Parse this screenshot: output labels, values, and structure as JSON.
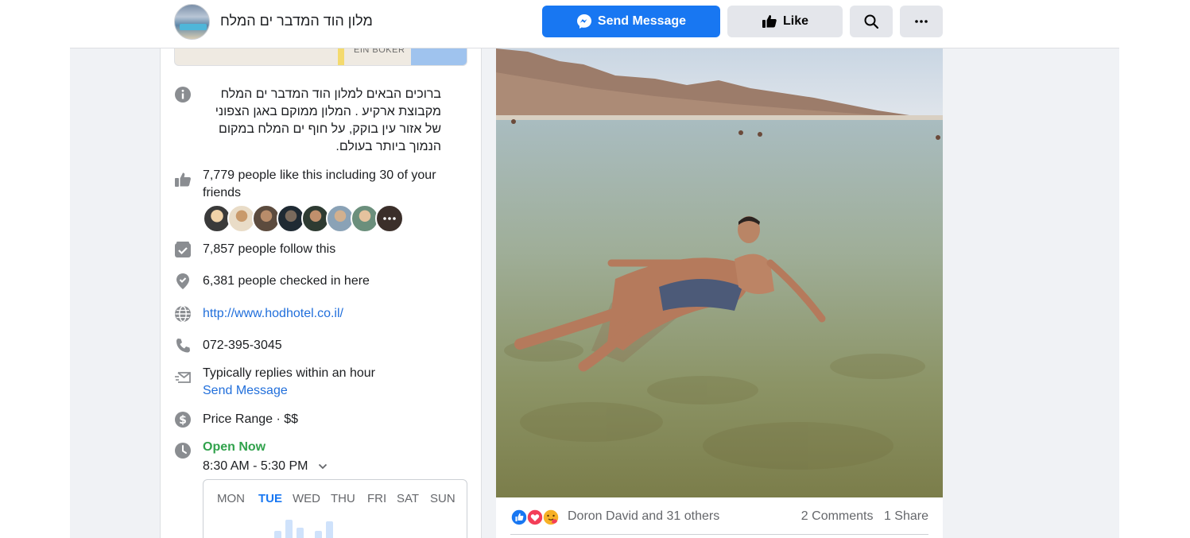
{
  "header": {
    "page_name": "מלון הוד המדבר ים המלח",
    "send_message_label": "Send Message",
    "like_label": "Like"
  },
  "map": {
    "label": "EIN BOKER"
  },
  "about": {
    "description": "ברוכים הבאים למלון הוד המדבר ים המלח מקבוצת ארקיע . המלון ממוקם באגן הצפוני של אזור עין בוקק, על חוף ים המלח במקום הנמוך ביותר בעולם.",
    "likes_line1": "7,779 people like this including 30 of your",
    "likes_line2": "friends",
    "follows": "7,857 people follow this",
    "checkins": "6,381 people checked in here",
    "website": "http://www.hodhotel.co.il/",
    "phone": "072-395-3045",
    "response_time": "Typically replies within an hour",
    "send_message_link": "Send Message",
    "price_range": "Price Range · $$",
    "open_status": "Open Now",
    "hours": "8:30 AM - 5:30 PM"
  },
  "hours_chart": {
    "days": [
      "MON",
      "TUE",
      "WED",
      "THU",
      "FRI",
      "SAT",
      "SUN"
    ],
    "active_day": "TUE"
  },
  "post": {
    "reactors": "Doron David and 31 others",
    "comments": "2 Comments",
    "shares": "1 Share"
  },
  "colors": {
    "brand_blue": "#1877f2",
    "link_blue": "#216fdb",
    "open_green": "#31a24c",
    "page_gray": "#f0f2f5"
  }
}
